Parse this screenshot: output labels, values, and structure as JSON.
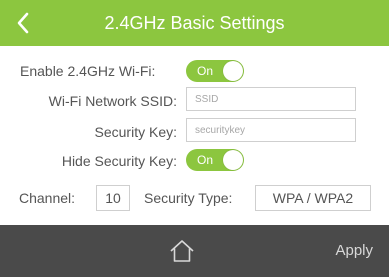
{
  "header": {
    "title": "2.4GHz Basic Settings",
    "back_icon": "chevron-left-icon"
  },
  "form": {
    "enable_wifi_label": "Enable 2.4GHz Wi-Fi:",
    "enable_wifi_state": "On",
    "ssid_label": "Wi-Fi Network SSID:",
    "ssid_placeholder": "SSID",
    "security_key_label": "Security Key:",
    "security_key_placeholder": "securitykey",
    "hide_key_label": "Hide Security Key:",
    "hide_key_state": "On",
    "channel_label": "Channel:",
    "channel_value": "10",
    "security_type_label": "Security Type:",
    "security_type_value": "WPA / WPA2"
  },
  "footer": {
    "home_icon": "home-icon",
    "apply_label": "Apply"
  },
  "colors": {
    "accent_green": "#8cc63f",
    "footer_bg": "#4a4a4a"
  }
}
